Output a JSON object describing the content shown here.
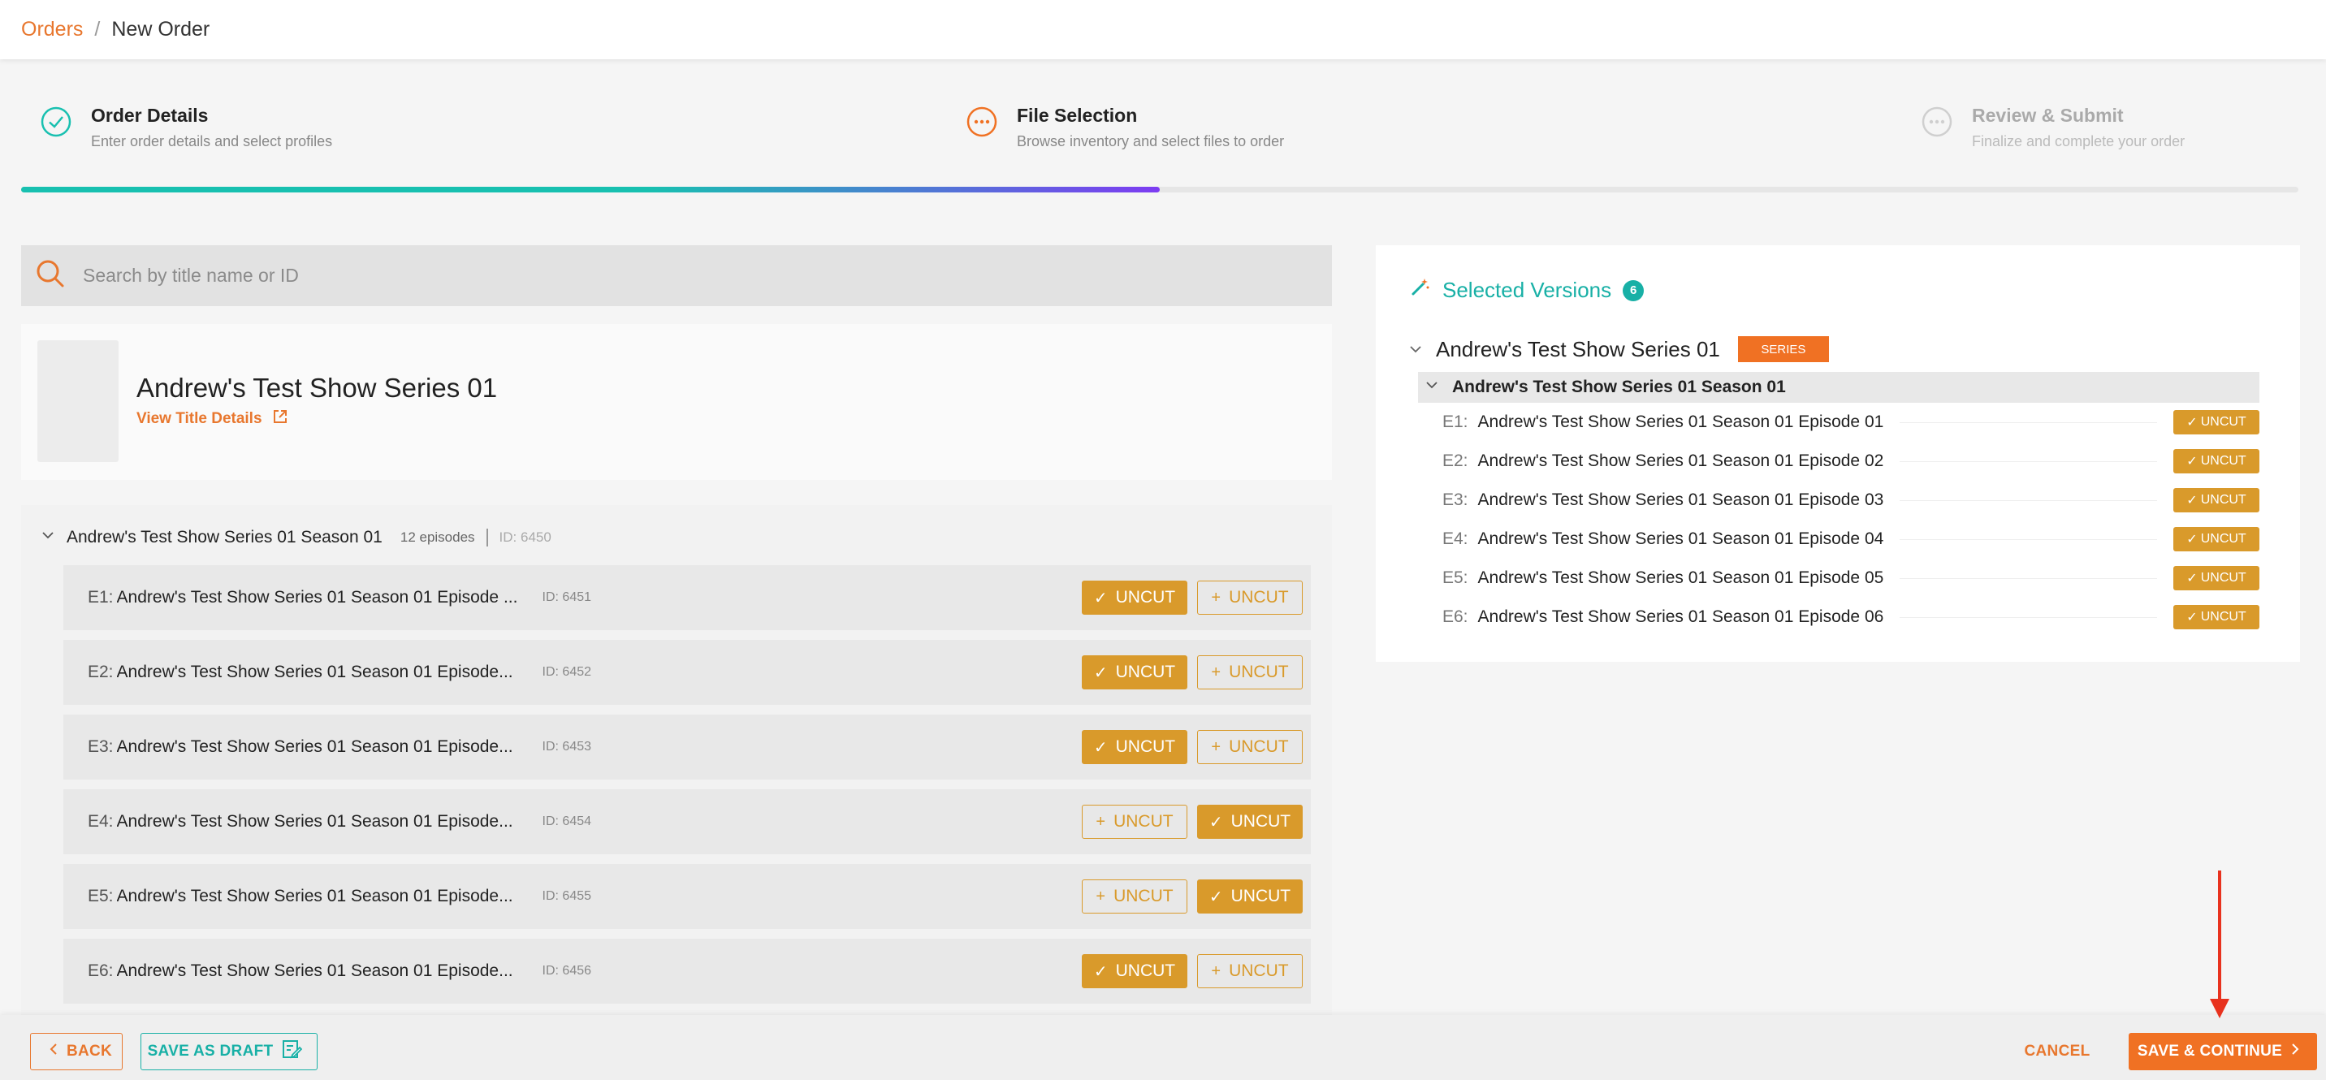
{
  "breadcrumb": {
    "root": "Orders",
    "separator": "/",
    "current": "New Order"
  },
  "stepper": {
    "steps": [
      {
        "title": "Order Details",
        "subtitle": "Enter order details and select profiles",
        "state": "complete",
        "icon": "check-circle-icon"
      },
      {
        "title": "File Selection",
        "subtitle": "Browse inventory and select files to order",
        "state": "active",
        "icon": "ellipsis-circle-icon"
      },
      {
        "title": "Review & Submit",
        "subtitle": "Finalize and complete your order",
        "state": "inactive",
        "icon": "ellipsis-circle-icon"
      }
    ],
    "progress_fraction": 0.5
  },
  "search": {
    "placeholder": "Search by title name or ID",
    "value": ""
  },
  "title_card": {
    "name": "Andrew's Test Show Series 01",
    "link_label": "View Title Details"
  },
  "season": {
    "name": "Andrew's Test Show Series 01 Season 01",
    "episode_count": "12 episodes",
    "id": "ID: 6450"
  },
  "episodes": [
    {
      "num": "E1:",
      "title": "Andrew's Test Show Series 01 Season 01 Episode ...",
      "id": "ID: 6451",
      "btn1": {
        "label": "UNCUT",
        "selected": true
      },
      "btn2": {
        "label": "UNCUT",
        "selected": false
      }
    },
    {
      "num": "E2:",
      "title": "Andrew's Test Show Series 01 Season 01 Episode...",
      "id": "ID: 6452",
      "btn1": {
        "label": "UNCUT",
        "selected": true
      },
      "btn2": {
        "label": "UNCUT",
        "selected": false
      }
    },
    {
      "num": "E3:",
      "title": "Andrew's Test Show Series 01 Season 01 Episode...",
      "id": "ID: 6453",
      "btn1": {
        "label": "UNCUT",
        "selected": true
      },
      "btn2": {
        "label": "UNCUT",
        "selected": false
      }
    },
    {
      "num": "E4:",
      "title": "Andrew's Test Show Series 01 Season 01 Episode...",
      "id": "ID: 6454",
      "btn1": {
        "label": "UNCUT",
        "selected": false
      },
      "btn2": {
        "label": "UNCUT",
        "selected": true
      }
    },
    {
      "num": "E5:",
      "title": "Andrew's Test Show Series 01 Season 01 Episode...",
      "id": "ID: 6455",
      "btn1": {
        "label": "UNCUT",
        "selected": false
      },
      "btn2": {
        "label": "UNCUT",
        "selected": true
      }
    },
    {
      "num": "E6:",
      "title": "Andrew's Test Show Series 01 Season 01 Episode...",
      "id": "ID: 6456",
      "btn1": {
        "label": "UNCUT",
        "selected": true
      },
      "btn2": {
        "label": "UNCUT",
        "selected": false
      }
    }
  ],
  "selected_versions": {
    "heading": "Selected Versions",
    "count": "6",
    "series_name": "Andrew's Test Show Series 01",
    "series_tag": "SERIES",
    "season_name": "Andrew's Test Show Series 01 Season 01",
    "items": [
      {
        "num": "E1:",
        "title": "Andrew's Test Show Series 01 Season 01 Episode 01",
        "tag": "UNCUT"
      },
      {
        "num": "E2:",
        "title": "Andrew's Test Show Series 01 Season 01 Episode 02",
        "tag": "UNCUT"
      },
      {
        "num": "E3:",
        "title": "Andrew's Test Show Series 01 Season 01 Episode 03",
        "tag": "UNCUT"
      },
      {
        "num": "E4:",
        "title": "Andrew's Test Show Series 01 Season 01 Episode 04",
        "tag": "UNCUT"
      },
      {
        "num": "E5:",
        "title": "Andrew's Test Show Series 01 Season 01 Episode 05",
        "tag": "UNCUT"
      },
      {
        "num": "E6:",
        "title": "Andrew's Test Show Series 01 Season 01 Episode 06",
        "tag": "UNCUT"
      }
    ]
  },
  "footer": {
    "back": "BACK",
    "save_draft": "SAVE AS DRAFT",
    "cancel": "CANCEL",
    "save_continue": "SAVE & CONTINUE"
  },
  "colors": {
    "brand_orange": "#f07123",
    "accent_teal": "#18b0a6",
    "uncut_gold": "#d99a2b",
    "progress_purple": "#7d3cf2",
    "annotation_red": "#e8321e"
  }
}
